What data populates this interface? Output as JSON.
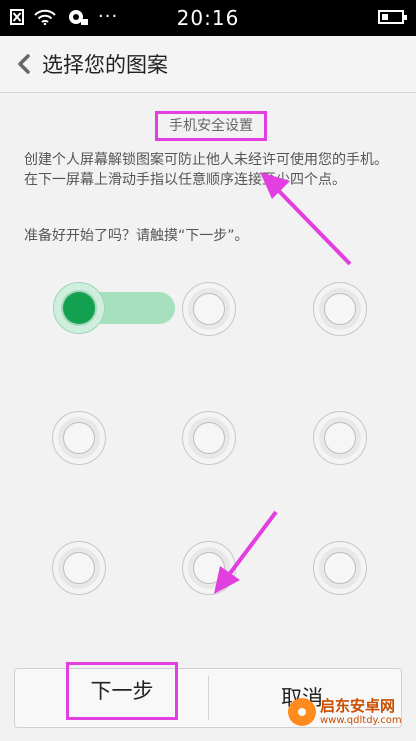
{
  "status_bar": {
    "time": "20:16",
    "more_indicator": "···"
  },
  "header": {
    "back_glyph": "‹",
    "title": "选择您的图案"
  },
  "content": {
    "section_title": "手机安全设置",
    "description": "创建个人屏幕解锁图案可防止他人未经许可使用您的手机。在下一屏幕上滑动手指以任意顺序连接至少四个点。",
    "prompt": "准备好开始了吗？请触摸“下一步”。"
  },
  "pattern": {
    "grid": "3x3",
    "active_dot": "row-1-col-1"
  },
  "buttons": {
    "next": "下一步",
    "cancel": "取消"
  },
  "watermark": {
    "name": "启东安卓网",
    "url": "www.qdltdy.com"
  },
  "colors": {
    "accent_green": "#13a050",
    "trail_green": "#a6e0bd",
    "highlight_magenta": "#e23ee0",
    "status_bar": "#000000"
  },
  "icons": [
    "sim-error-icon",
    "wifi-icon",
    "notification-icon",
    "battery-icon",
    "back-chevron-icon"
  ]
}
